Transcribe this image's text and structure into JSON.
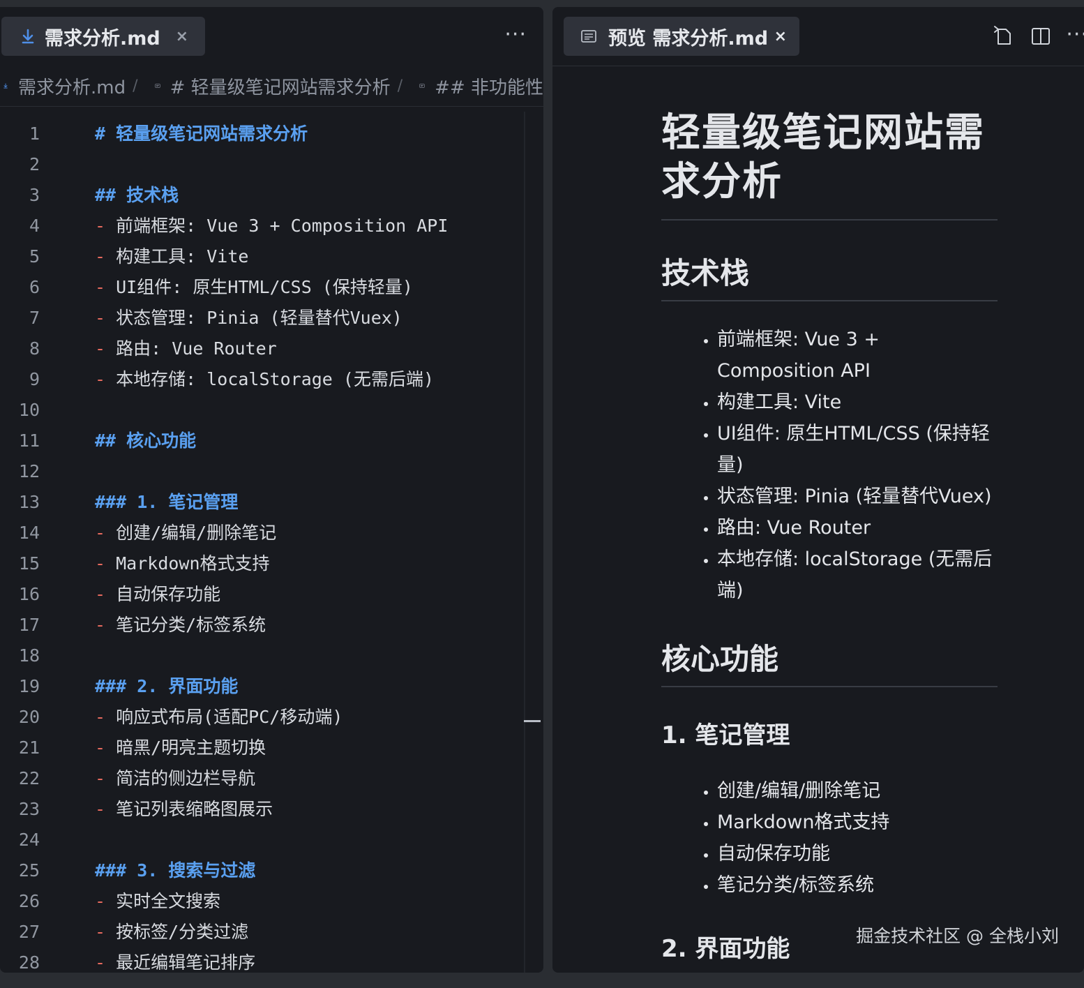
{
  "editor": {
    "tab_title": "需求分析.md",
    "tab_close": "×",
    "more": "···",
    "breadcrumb": {
      "file": "需求分析.md",
      "sep": "/",
      "h1": "# 轻量级笔记网站需求分析",
      "h2": "## 非功能性"
    },
    "lines": [
      {
        "n": "1",
        "kind": "heading",
        "text": "# 轻量级笔记网站需求分析"
      },
      {
        "n": "2",
        "kind": "blank",
        "text": ""
      },
      {
        "n": "3",
        "kind": "heading",
        "text": "## 技术栈"
      },
      {
        "n": "4",
        "kind": "item",
        "text": "前端框架: Vue 3 + Composition API"
      },
      {
        "n": "5",
        "kind": "item",
        "text": "构建工具: Vite"
      },
      {
        "n": "6",
        "kind": "item",
        "text": "UI组件: 原生HTML/CSS (保持轻量)"
      },
      {
        "n": "7",
        "kind": "item",
        "text": "状态管理: Pinia (轻量替代Vuex)"
      },
      {
        "n": "8",
        "kind": "item",
        "text": "路由: Vue Router"
      },
      {
        "n": "9",
        "kind": "item",
        "text": "本地存储: localStorage (无需后端)"
      },
      {
        "n": "10",
        "kind": "blank",
        "text": ""
      },
      {
        "n": "11",
        "kind": "heading",
        "text": "## 核心功能"
      },
      {
        "n": "12",
        "kind": "blank",
        "text": ""
      },
      {
        "n": "13",
        "kind": "heading",
        "text": "### 1. 笔记管理"
      },
      {
        "n": "14",
        "kind": "item",
        "text": "创建/编辑/删除笔记"
      },
      {
        "n": "15",
        "kind": "item",
        "text": "Markdown格式支持"
      },
      {
        "n": "16",
        "kind": "item",
        "text": "自动保存功能"
      },
      {
        "n": "17",
        "kind": "item",
        "text": "笔记分类/标签系统"
      },
      {
        "n": "18",
        "kind": "blank",
        "text": ""
      },
      {
        "n": "19",
        "kind": "heading",
        "text": "### 2. 界面功能"
      },
      {
        "n": "20",
        "kind": "item",
        "text": "响应式布局(适配PC/移动端)"
      },
      {
        "n": "21",
        "kind": "item",
        "text": "暗黑/明亮主题切换"
      },
      {
        "n": "22",
        "kind": "item",
        "text": "简洁的侧边栏导航"
      },
      {
        "n": "23",
        "kind": "item",
        "text": "笔记列表缩略图展示"
      },
      {
        "n": "24",
        "kind": "blank",
        "text": ""
      },
      {
        "n": "25",
        "kind": "heading",
        "text": "### 3. 搜索与过滤"
      },
      {
        "n": "26",
        "kind": "item",
        "text": "实时全文搜索"
      },
      {
        "n": "27",
        "kind": "item",
        "text": "按标签/分类过滤"
      },
      {
        "n": "28",
        "kind": "item",
        "text": "最近编辑笔记排序"
      }
    ],
    "dash": "-"
  },
  "preview": {
    "tab_title": "预览 需求分析.md",
    "tab_close": "×",
    "more": "···",
    "h1": "轻量级笔记网站需求分析",
    "tech_title": "技术栈",
    "tech_items": [
      "前端框架: Vue 3 + Composition API",
      "构建工具: Vite",
      "UI组件: 原生HTML/CSS (保持轻量)",
      "状态管理: Pinia (轻量替代Vuex)",
      "路由: Vue Router",
      "本地存储: localStorage (无需后端)"
    ],
    "core_title": "核心功能",
    "notes_title": "1. 笔记管理",
    "notes_items": [
      "创建/编辑/删除笔记",
      "Markdown格式支持",
      "自动保存功能",
      "笔记分类/标签系统"
    ],
    "ui_title": "2. 界面功能"
  },
  "watermark": "掘金技术社区 @ 全栈小刘",
  "colors": {
    "heading": "#5aa0f0",
    "dash": "#e76a5e",
    "bg": "#181a1f",
    "tab_active": "#2f323a"
  }
}
